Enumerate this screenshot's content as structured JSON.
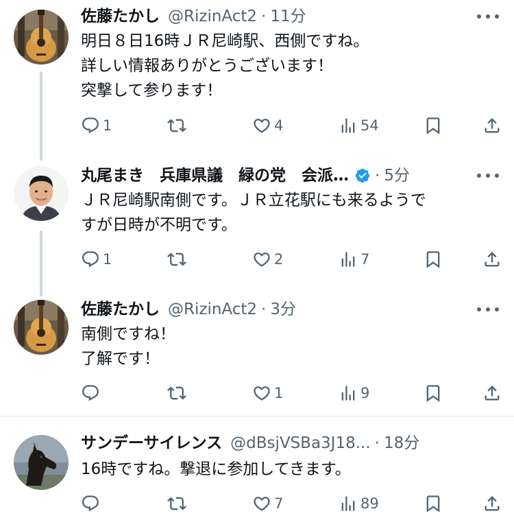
{
  "tweets": [
    {
      "name": "佐藤たかし",
      "handle": "@RizinAct2",
      "separator": "·",
      "time": "11分",
      "verified": false,
      "avatar": "guitar-avatar",
      "text": "明日８日16時ＪＲ尼崎駅、西側ですね。\n詳しい情報ありがとうございます！\n突撃して参ります！",
      "stats": {
        "replies": "1",
        "retweets": "",
        "likes": "4",
        "views": "54"
      }
    },
    {
      "name": "丸尾まき　兵庫県議　緑の党　会派…",
      "handle": "",
      "separator": "·",
      "time": "5分",
      "verified": true,
      "avatar": "man-portrait-avatar",
      "text": "ＪＲ尼崎駅南側です。ＪＲ立花駅にも来るようで\nすが日時が不明です。",
      "stats": {
        "replies": "1",
        "retweets": "",
        "likes": "2",
        "views": "7"
      }
    },
    {
      "name": "佐藤たかし",
      "handle": "@RizinAct2",
      "separator": "·",
      "time": "3分",
      "verified": false,
      "avatar": "guitar-avatar",
      "text": "南側ですね！\n了解です！",
      "stats": {
        "replies": "",
        "retweets": "",
        "likes": "1",
        "views": "9"
      }
    },
    {
      "name": "サンデーサイレンス",
      "handle": "@dBsjVSBa3J18...",
      "separator": "·",
      "time": "18分",
      "verified": false,
      "avatar": "horse-avatar",
      "text": "16時ですね。撃退に参加してきます。",
      "stats": {
        "replies": "",
        "retweets": "",
        "likes": "7",
        "views": "89"
      }
    }
  ],
  "colors": {
    "text": "#0f1419",
    "secondary": "#536471",
    "verified": "#1d9bf0",
    "thread_line": "#cfd9de"
  },
  "icons": [
    "reply-icon",
    "retweet-icon",
    "like-icon",
    "views-icon",
    "bookmark-icon",
    "share-icon",
    "more-icon",
    "verified-badge-icon"
  ]
}
